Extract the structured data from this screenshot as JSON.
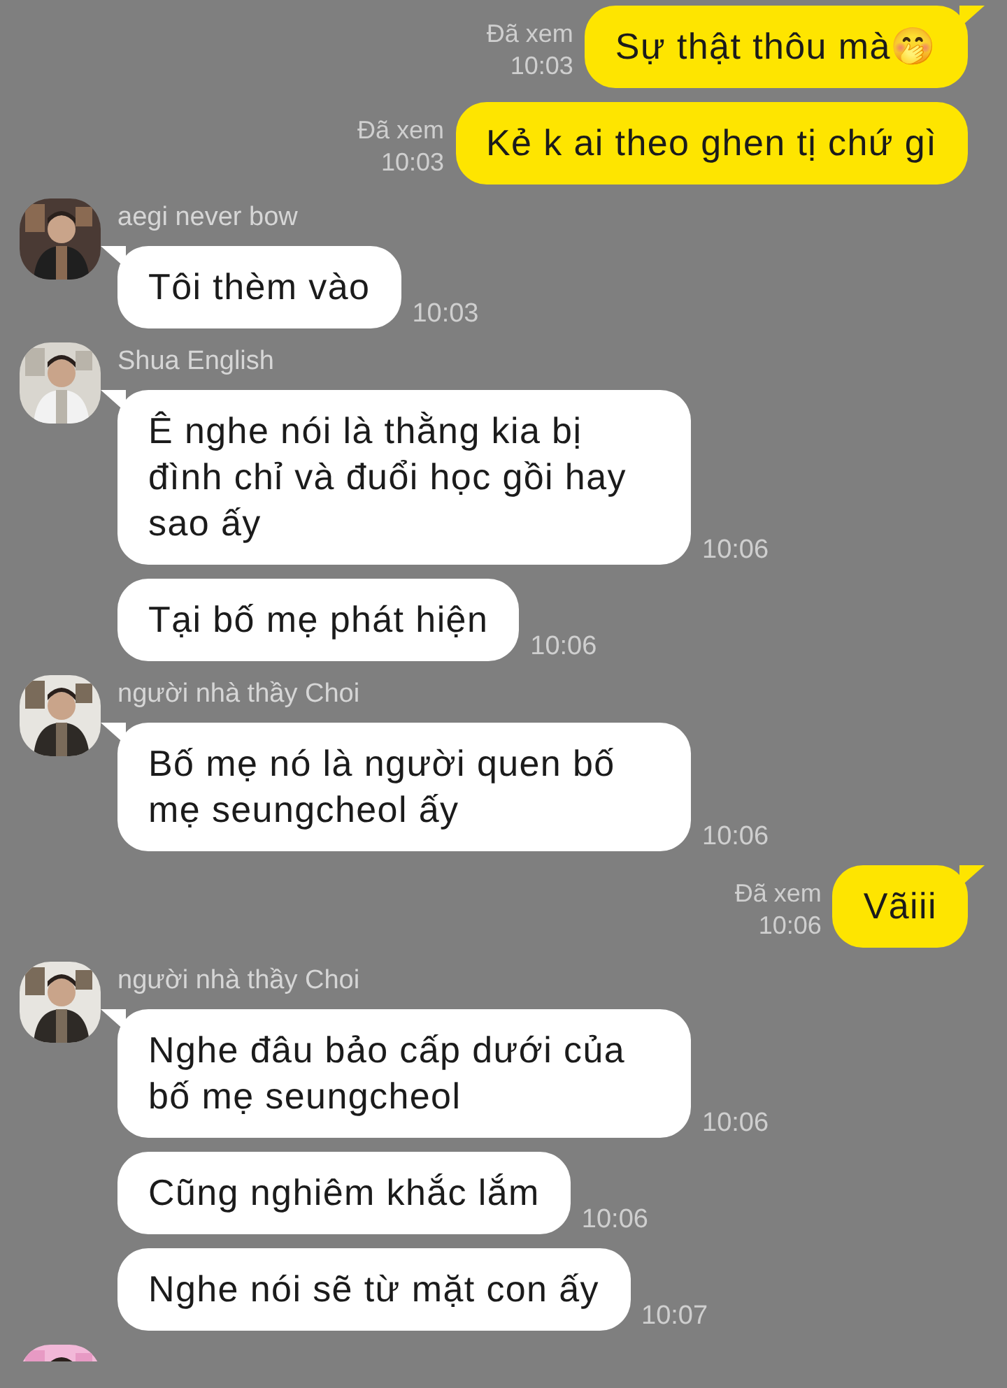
{
  "messages": [
    {
      "kind": "sent",
      "text": "Sự thật thôu mà🤭",
      "read": "Đã xem",
      "time": "10:03"
    },
    {
      "kind": "sent",
      "text": "Kẻ k ai theo ghen tị chứ gì",
      "read": "Đã xem",
      "time": "10:03"
    },
    {
      "kind": "received",
      "sender": "aegi never bow",
      "avatar": {
        "kind": "picture"
      },
      "bubbles": [
        {
          "text": "Tôi thèm vào",
          "time": "10:03"
        }
      ]
    },
    {
      "kind": "received",
      "sender": "Shua English",
      "avatar": {
        "kind": "picture"
      },
      "bubbles": [
        {
          "text": "Ê nghe nói là thằng kia bị đình chỉ và đuổi học gồi hay sao ấy",
          "time": "10:06"
        },
        {
          "text": "Tại bố mẹ phát hiện",
          "time": "10:06"
        }
      ]
    },
    {
      "kind": "received",
      "sender": "người nhà thầy Choi",
      "avatar": {
        "kind": "picture"
      },
      "bubbles": [
        {
          "text": "Bố mẹ nó là người quen bố mẹ seungcheol ấy",
          "time": "10:06"
        }
      ]
    },
    {
      "kind": "sent",
      "text": "Vãiii",
      "read": "Đã xem",
      "time": "10:06"
    },
    {
      "kind": "received",
      "sender": "người nhà thầy Choi",
      "avatar": {
        "kind": "picture"
      },
      "bubbles": [
        {
          "text": "Nghe đâu bảo cấp dưới của bố mẹ seungcheol",
          "time": "10:06"
        },
        {
          "text": "Cũng nghiêm khắc lắm",
          "time": "10:06"
        },
        {
          "text": "Nghe nói sẽ từ mặt con ấy",
          "time": "10:07"
        }
      ]
    },
    {
      "kind": "avatar_only",
      "avatar": {
        "kind": "picture"
      }
    }
  ]
}
